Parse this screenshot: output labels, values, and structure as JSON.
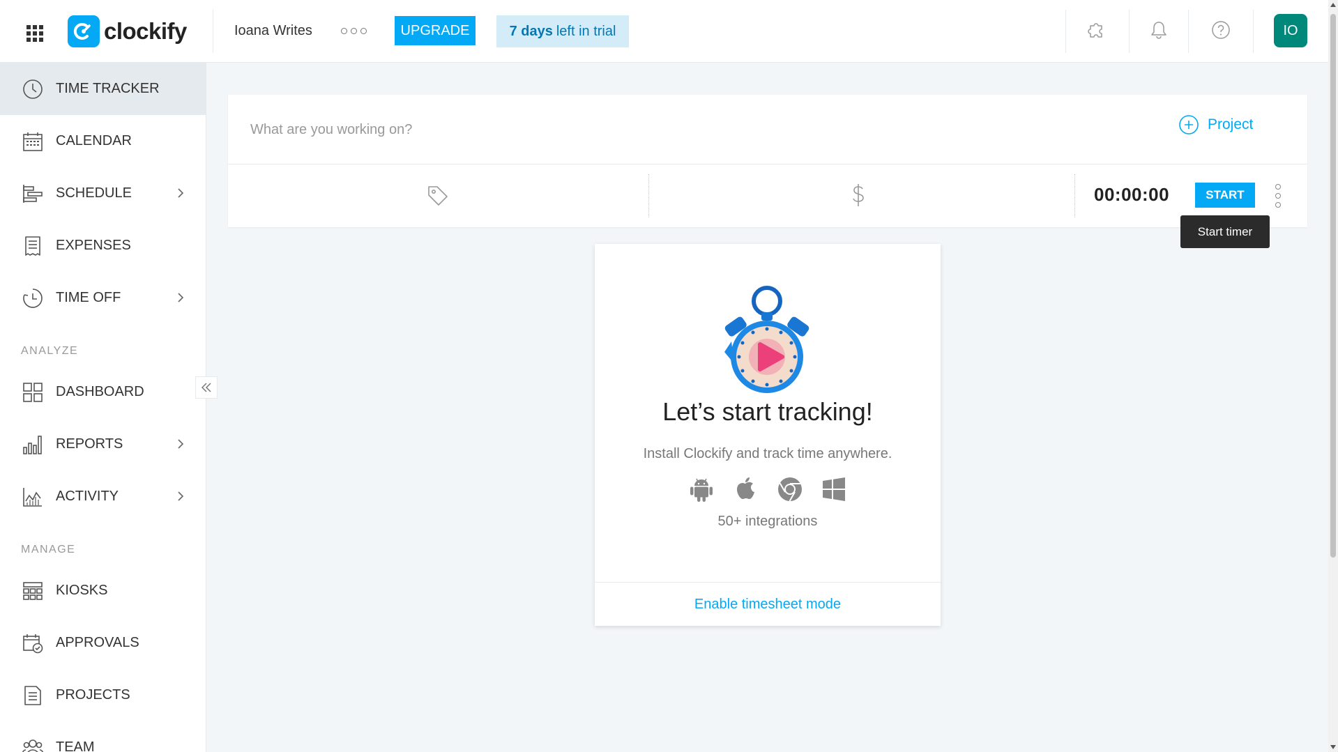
{
  "header": {
    "logo_text": "clockify",
    "workspace_name": "Ioana Writes",
    "upgrade_label": "UPGRADE",
    "trial_days": "7 days",
    "trial_rest": "left in trial",
    "avatar_initials": "IO",
    "icons": [
      "apps-grid-icon",
      "puzzle-icon",
      "bell-icon",
      "help-icon"
    ]
  },
  "sidebar": {
    "items": [
      {
        "label": "TIME TRACKER",
        "icon": "clock-icon",
        "active": true
      },
      {
        "label": "CALENDAR",
        "icon": "calendar-icon"
      },
      {
        "label": "SCHEDULE",
        "icon": "schedule-icon",
        "expandable": true
      },
      {
        "label": "EXPENSES",
        "icon": "receipt-icon"
      },
      {
        "label": "TIME OFF",
        "icon": "time-off-icon",
        "expandable": true
      }
    ],
    "analyze_label": "ANALYZE",
    "analyze_items": [
      {
        "label": "DASHBOARD",
        "icon": "dashboard-icon"
      },
      {
        "label": "REPORTS",
        "icon": "bar-chart-icon",
        "expandable": true
      },
      {
        "label": "ACTIVITY",
        "icon": "activity-icon",
        "expandable": true
      }
    ],
    "manage_label": "MANAGE",
    "manage_items": [
      {
        "label": "KIOSKS",
        "icon": "kiosk-icon"
      },
      {
        "label": "APPROVALS",
        "icon": "approvals-icon"
      },
      {
        "label": "PROJECTS",
        "icon": "projects-icon"
      },
      {
        "label": "TEAM",
        "icon": "team-icon"
      }
    ]
  },
  "timer": {
    "description_placeholder": "What are you working on?",
    "project_label": "Project",
    "time": "00:00:00",
    "start_label": "START",
    "tooltip": "Start timer"
  },
  "empty_state": {
    "title": "Let’s start tracking!",
    "subtitle": "Install Clockify and track time anywhere.",
    "platforms": [
      "android-icon",
      "apple-icon",
      "chrome-icon",
      "windows-icon"
    ],
    "integrations": "50+ integrations",
    "timesheet_link": "Enable timesheet mode"
  },
  "colors": {
    "accent": "#03a9f4",
    "avatar": "#00897b",
    "trial_bg": "#d4ecf8",
    "active_nav": "#e4eaee"
  }
}
